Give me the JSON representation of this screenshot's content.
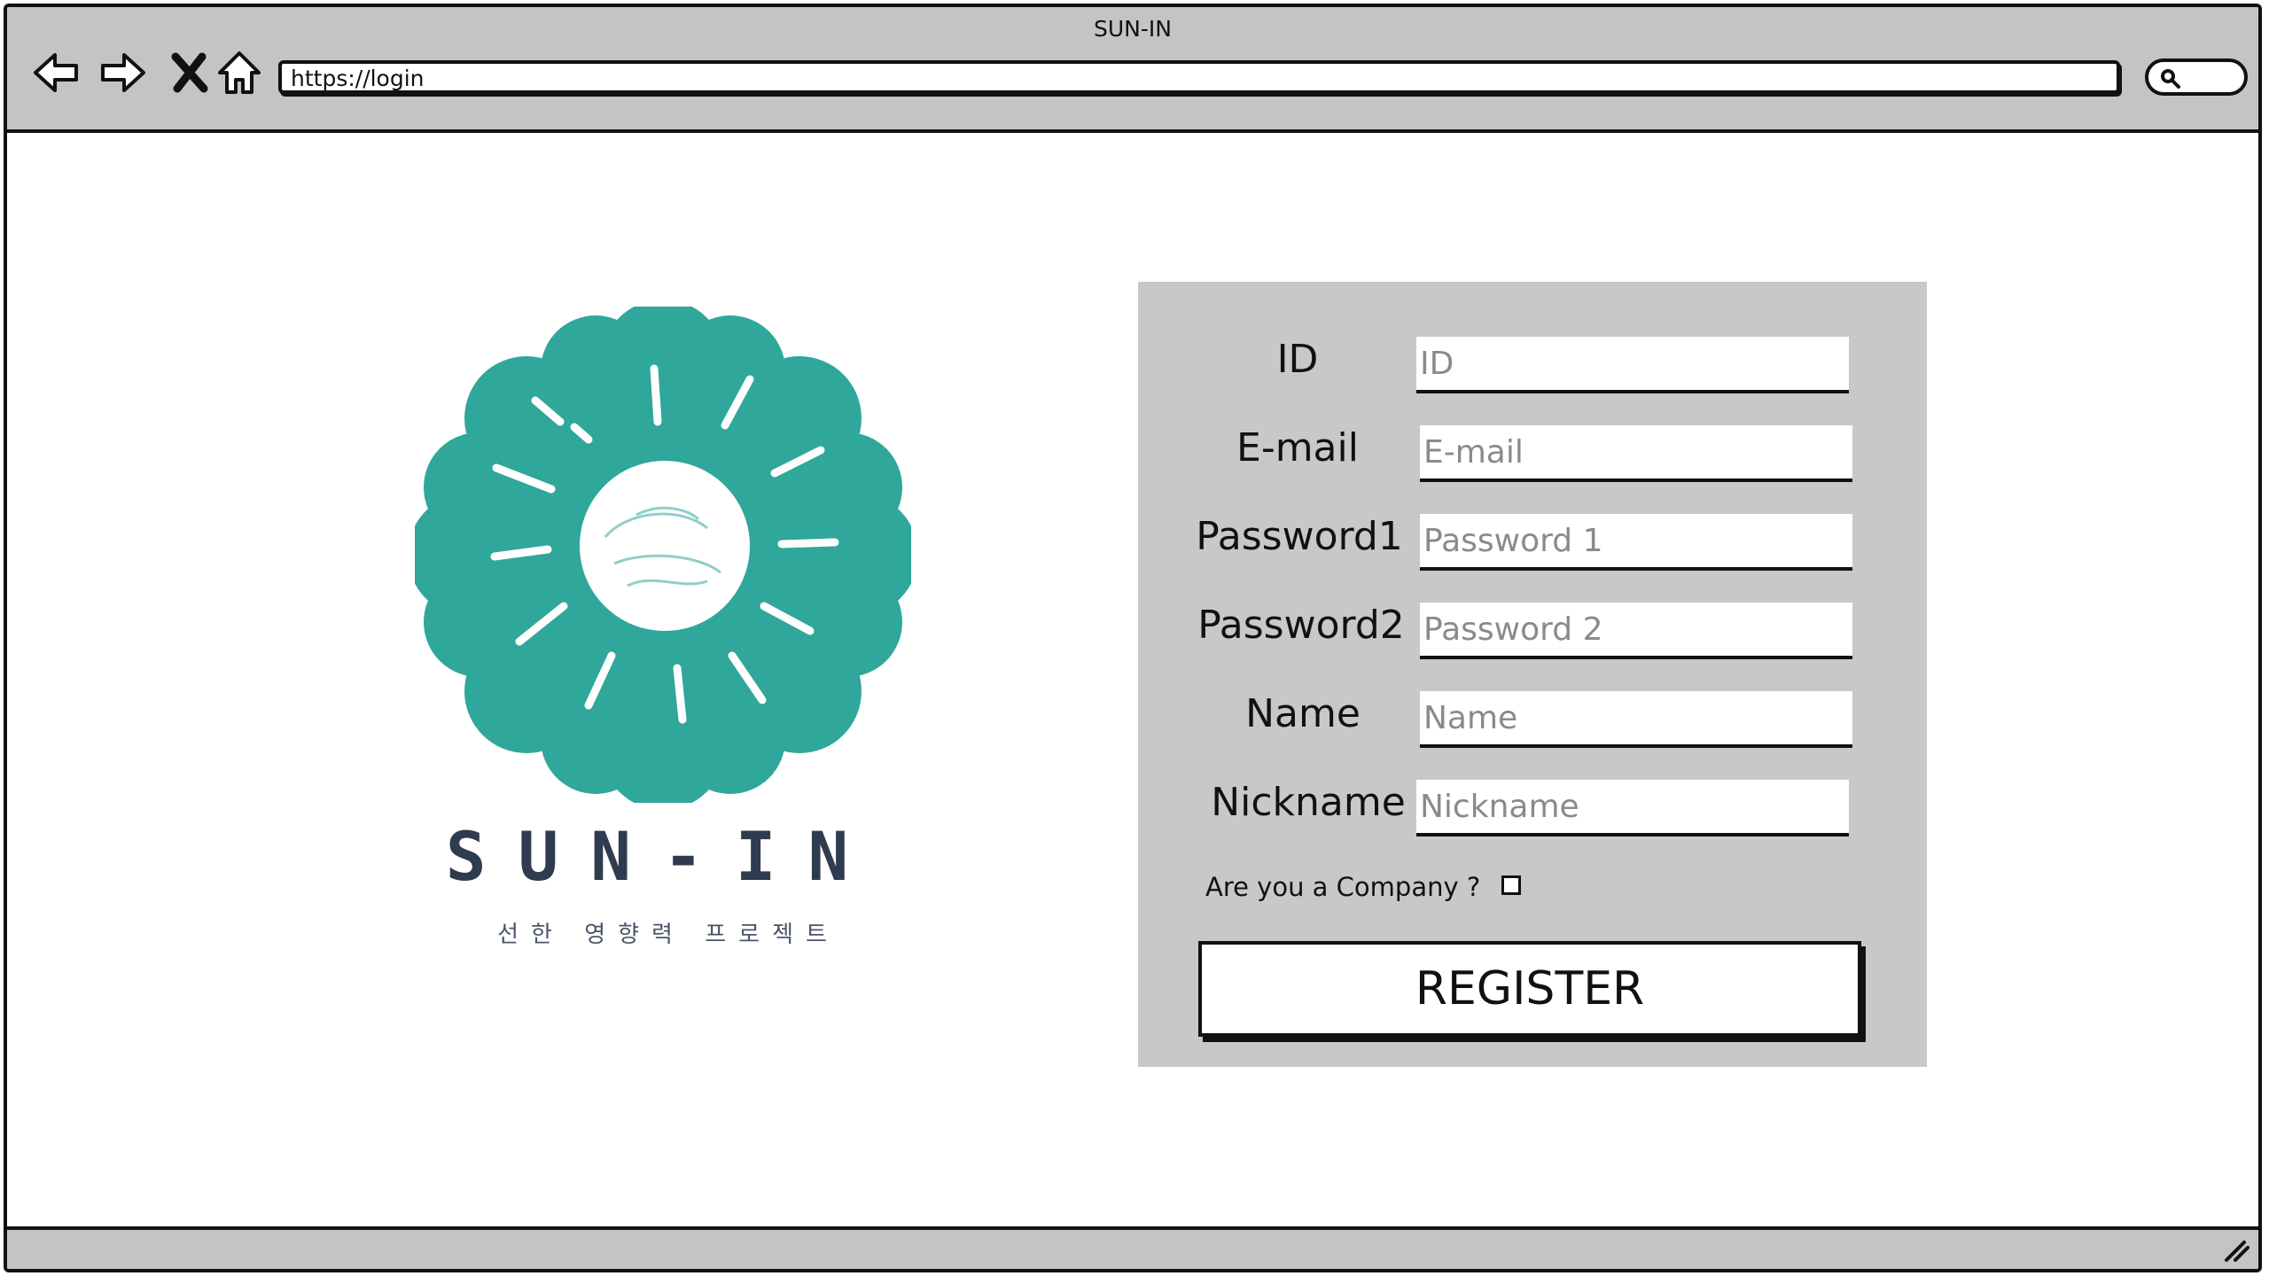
{
  "window": {
    "title": "SUN-IN"
  },
  "toolbar": {
    "back_icon": "back-arrow-icon",
    "forward_icon": "forward-arrow-icon",
    "stop_icon": "close-icon",
    "home_icon": "home-icon",
    "url": "https://login",
    "search_icon": "search-icon"
  },
  "brand": {
    "name": "SUN-IN",
    "subtitle": "선한 영향력 프로젝트",
    "logo_color": "#2fa79a",
    "text_color": "#2f3b4e"
  },
  "form": {
    "fields": [
      {
        "label": "ID",
        "placeholder": "ID"
      },
      {
        "label": "E-mail",
        "placeholder": "E-mail"
      },
      {
        "label": "Password1",
        "placeholder": "Password 1"
      },
      {
        "label": "Password2",
        "placeholder": "Password 2"
      },
      {
        "label": "Name",
        "placeholder": "Name"
      },
      {
        "label": "Nickname",
        "placeholder": "Nickname"
      }
    ],
    "company_question": "Are you a Company ?",
    "company_checked": false,
    "register_label": "REGISTER",
    "panel_color": "#c8c8c8"
  }
}
